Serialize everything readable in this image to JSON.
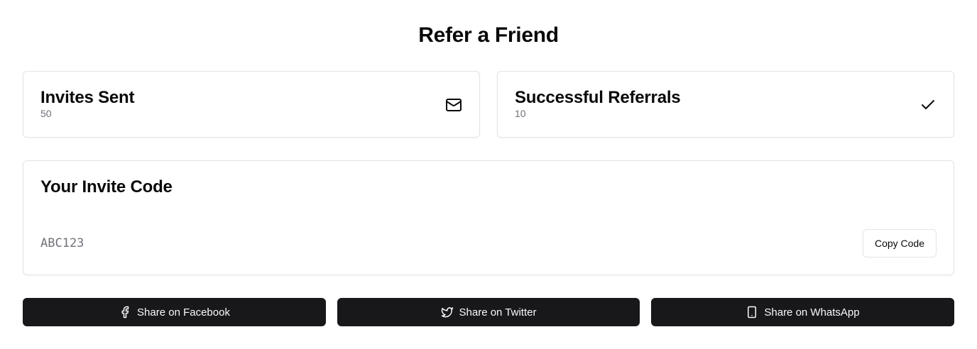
{
  "page": {
    "title": "Refer a Friend"
  },
  "stats": [
    {
      "title": "Invites Sent",
      "value": "50",
      "icon": "mail-icon"
    },
    {
      "title": "Successful Referrals",
      "value": "10",
      "icon": "check-icon"
    }
  ],
  "invite": {
    "title": "Your Invite Code",
    "code": "ABC123",
    "copy_label": "Copy Code"
  },
  "share": {
    "facebook_label": "Share on Facebook",
    "twitter_label": "Share on Twitter",
    "whatsapp_label": "Share on WhatsApp"
  },
  "colors": {
    "button_bg": "#18181b",
    "button_text": "#fafafa",
    "border": "#e4e4e7",
    "muted_text": "#71717a"
  }
}
